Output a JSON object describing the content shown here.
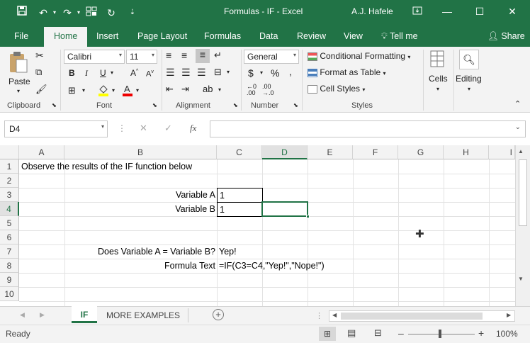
{
  "window": {
    "title": "Formulas - IF  -  Excel",
    "user": "A.J. Hafele"
  },
  "tabs": [
    "File",
    "Home",
    "Insert",
    "Page Layout",
    "Formulas",
    "Data",
    "Review",
    "View"
  ],
  "tell_me": "Tell me",
  "share": "Share",
  "ribbon": {
    "paste": "Paste",
    "font_name": "Calibri",
    "font_size": "11",
    "number_format": "General",
    "conditional_formatting": "Conditional Formatting",
    "format_as_table": "Format as Table",
    "cell_styles": "Cell Styles",
    "cells": "Cells",
    "editing": "Editing",
    "groups": {
      "clipboard": "Clipboard",
      "font": "Font",
      "alignment": "Alignment",
      "number": "Number",
      "styles": "Styles"
    }
  },
  "formula_bar": {
    "name_box": "D4",
    "formula": ""
  },
  "sheet": {
    "columns": [
      "A",
      "B",
      "C",
      "D",
      "E",
      "F",
      "G",
      "H",
      "I"
    ],
    "rows": [
      "1",
      "2",
      "3",
      "4",
      "5",
      "6",
      "7",
      "8",
      "9",
      "10"
    ],
    "cells": {
      "A1": "Observe the results of the IF function below",
      "B3": "Variable A",
      "C3": "1",
      "B4": "Variable B",
      "C4": "1",
      "B7": "Does Variable A = Variable B?",
      "C7": "Yep!",
      "B8": "Formula Text",
      "C8": "=IF(C3=C4,\"Yep!\",\"Nope!\")"
    },
    "active_cell": "D4"
  },
  "sheet_tabs": [
    "IF",
    "MORE EXAMPLES"
  ],
  "active_sheet": "IF",
  "status": {
    "ready": "Ready",
    "zoom": "100%"
  },
  "colors": {
    "accent": "#217346"
  }
}
